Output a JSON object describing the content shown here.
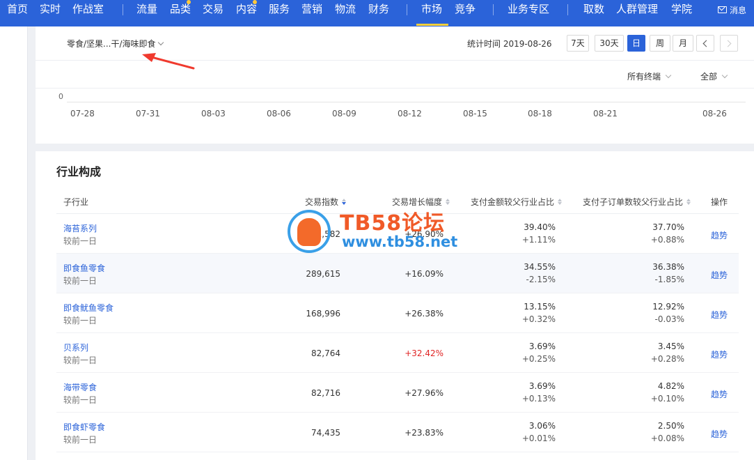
{
  "nav": {
    "items": [
      "首页",
      "实时",
      "作战室",
      "流量",
      "品类",
      "交易",
      "内容",
      "服务",
      "营销",
      "物流",
      "财务",
      "市场",
      "竞争",
      "业务专区",
      "取数",
      "人群管理",
      "学院"
    ],
    "active": "市场",
    "message_label": "消息",
    "accent_color": "#2b63d9"
  },
  "trend_panel": {
    "breadcrumb": "零食/坚果...干/海味即食",
    "stat_time": "统计时间 2019-08-26",
    "range_buttons": [
      "7天",
      "30天",
      "日",
      "周",
      "月"
    ],
    "active_range": "日",
    "filter_terminal": "所有终端",
    "filter_all": "全部",
    "y_zero": "0",
    "x_ticks": [
      "07-28",
      "07-31",
      "08-03",
      "08-06",
      "08-09",
      "08-12",
      "08-15",
      "08-18",
      "08-21",
      "08-26"
    ]
  },
  "industry": {
    "title": "行业构成",
    "headers": {
      "sub_industry": "子行业",
      "trade_index": "交易指数",
      "trade_growth": "交易增长幅度",
      "pay_share": "支付金额较父行业占比",
      "order_share": "支付子订单数较父行业占比",
      "action": "操作"
    },
    "rows": [
      {
        "name": "海苔系列",
        "compare": "较前一日",
        "index": "311,582",
        "growth": "+26.90%",
        "pay": "39.40%",
        "pay_delta": "+1.11%",
        "order": "37.70%",
        "order_delta": "+0.88%",
        "action": "趋势"
      },
      {
        "name": "即食鱼零食",
        "compare": "较前一日",
        "index": "289,615",
        "growth": "+16.09%",
        "pay": "34.55%",
        "pay_delta": "-2.15%",
        "order": "36.38%",
        "order_delta": "-1.85%",
        "action": "趋势"
      },
      {
        "name": "即食鱿鱼零食",
        "compare": "较前一日",
        "index": "168,996",
        "growth": "+26.38%",
        "pay": "13.15%",
        "pay_delta": "+0.32%",
        "order": "12.92%",
        "order_delta": "-0.03%",
        "action": "趋势"
      },
      {
        "name": "贝系列",
        "compare": "较前一日",
        "index": "82,764",
        "growth": "+32.42%",
        "pay": "3.69%",
        "pay_delta": "+0.25%",
        "order": "3.45%",
        "order_delta": "+0.28%",
        "action": "趋势"
      },
      {
        "name": "海带零食",
        "compare": "较前一日",
        "index": "82,716",
        "growth": "+27.96%",
        "pay": "3.69%",
        "pay_delta": "+0.13%",
        "order": "4.82%",
        "order_delta": "+0.10%",
        "action": "趋势"
      },
      {
        "name": "即食虾零食",
        "compare": "较前一日",
        "index": "74,435",
        "growth": "+23.83%",
        "pay": "3.06%",
        "pay_delta": "+0.01%",
        "order": "2.50%",
        "order_delta": "+0.08%",
        "action": "趋势"
      }
    ]
  },
  "watermark": {
    "title": "TB58论坛",
    "url": "www.tb58.net"
  }
}
